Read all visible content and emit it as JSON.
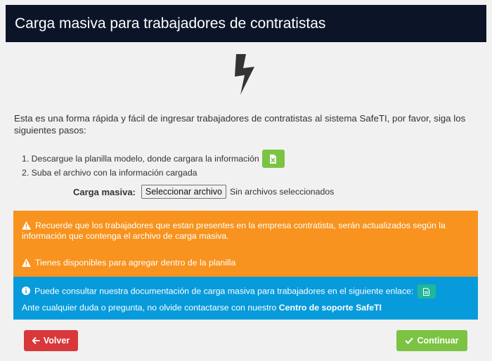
{
  "header": {
    "title": "Carga masiva para trabajadores de contratistas"
  },
  "icons": {
    "hero": "bolt-icon",
    "excel": "file-excel-icon",
    "warning": "warning-icon",
    "info": "info-circle-icon",
    "document": "file-icon",
    "back": "arrow-left-icon",
    "check": "check-icon"
  },
  "intro": {
    "text": "Esta es una forma rápida y fácil de ingresar trabajadores de contratistas al sistema SafeTI, por favor, siga los siguientes pasos:"
  },
  "steps": [
    {
      "text": "1. Descargue la planilla modelo, donde cargara la información"
    },
    {
      "text": "2. Suba el archivo con la información cargada"
    }
  ],
  "upload": {
    "label": "Carga masiva:",
    "button_label": "Seleccionar archivo",
    "status": "Sin archivos seleccionados"
  },
  "alerts": {
    "warning_1": "Recuerde que los trabajadores que estan presentes en la empresa contratista, serán actualizados según la información que contenga el archivo de carga masiva.",
    "warning_2": "Tienes disponibles para agregar dentro de la planilla",
    "info_line1": "Puede consultar nuestra documentación de carga masiva para trabajadores en el siguiente enlace:",
    "info_line2_prefix": "Ante cualquier duda o pregunta, no olvide contactarse con nuestro ",
    "info_line2_link": "Centro de soporte SafeTI"
  },
  "buttons": {
    "back": "Volver",
    "continue": "Continuar"
  },
  "colors": {
    "header_bg": "#0c1528",
    "warning_bg": "#f7931e",
    "info_bg": "#079bdc",
    "success": "#7bc342",
    "danger": "#d9383a",
    "teal": "#21b79a"
  }
}
